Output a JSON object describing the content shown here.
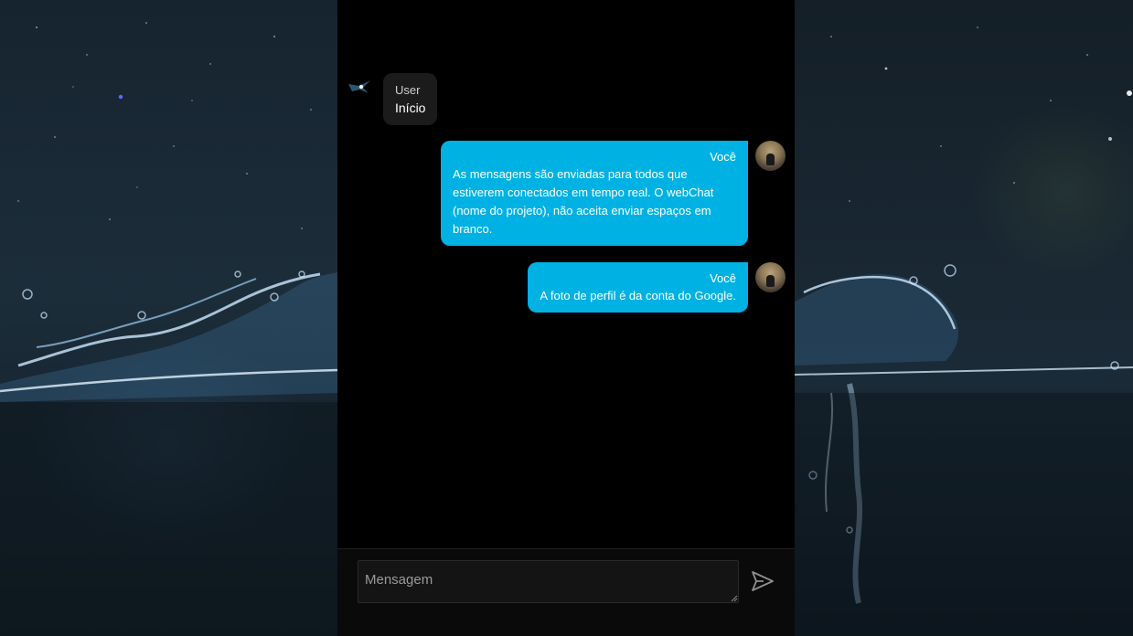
{
  "chat": {
    "messages": [
      {
        "author": "User",
        "text": "Início",
        "direction": "incoming"
      },
      {
        "author": "Você",
        "text": "As mensagens são enviadas para todos que estiverem conectados em tempo real. O webChat (nome do projeto), não aceita enviar espaços em branco.",
        "direction": "outgoing"
      },
      {
        "author": "Você",
        "text": "A foto de perfil é da conta do Google.",
        "direction": "outgoing"
      }
    ]
  },
  "composer": {
    "placeholder": "Mensagem",
    "value": "",
    "send_icon": "send-icon"
  },
  "colors": {
    "outgoing_bubble": "#00b2e3",
    "incoming_bubble": "#1b1b1b",
    "panel_background": "#000000"
  }
}
